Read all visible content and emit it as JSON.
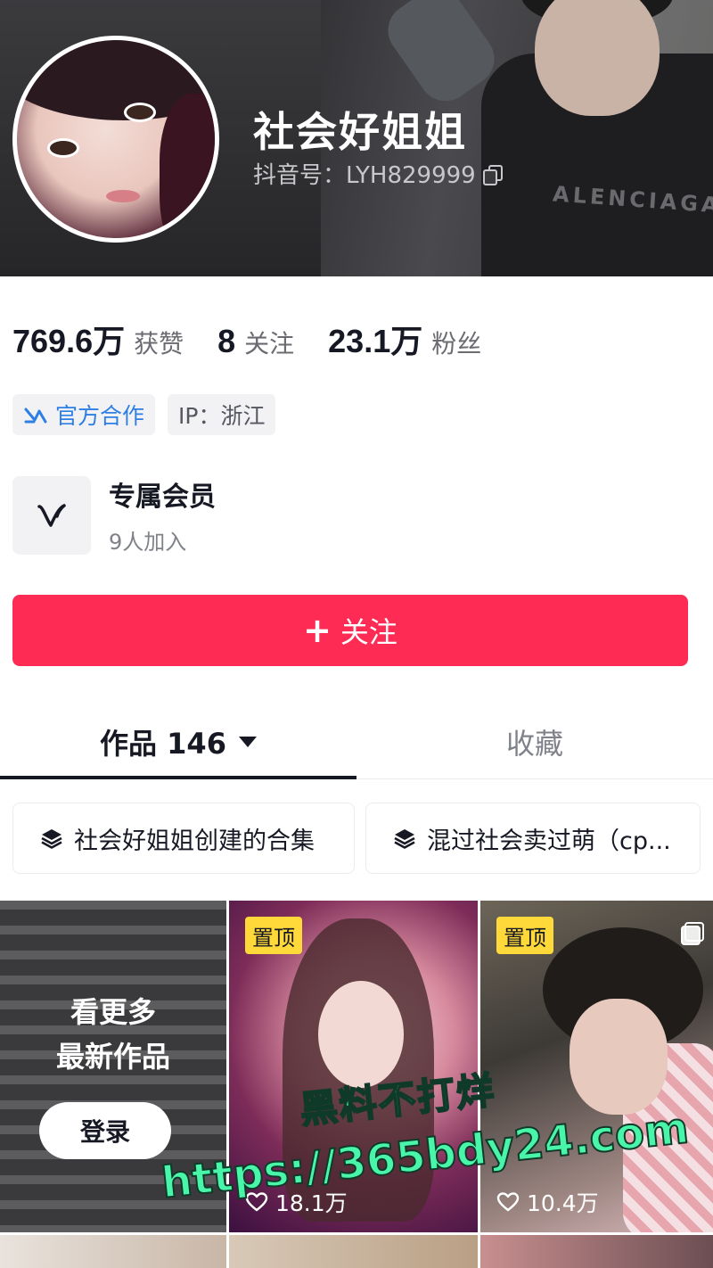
{
  "profile": {
    "nickname": "社会好姐姐",
    "douyin_id": "抖音号：LYH829999"
  },
  "stats": [
    {
      "value": "769.6万",
      "label": "获赞"
    },
    {
      "value": "8",
      "label": "关注"
    },
    {
      "value": "23.1万",
      "label": "粉丝"
    }
  ],
  "tags": {
    "official": "官方合作",
    "ip": "IP：浙江"
  },
  "member": {
    "title": "专属会员",
    "subtitle": "9人加入"
  },
  "follow_button": {
    "plus": "+",
    "label": "关注"
  },
  "tabs": {
    "works": "作品 146",
    "favorites": "收藏"
  },
  "collections": [
    {
      "label": "社会好姐姐创建的合集"
    },
    {
      "label": "混过社会卖过萌（cp..."
    }
  ],
  "grid": {
    "more_line1": "看更多",
    "more_line2": "最新作品",
    "login": "登录",
    "items": [
      {
        "pinned": "置顶",
        "likes": "18.1万"
      },
      {
        "pinned": "置顶",
        "likes": "10.4万"
      }
    ]
  },
  "cover": {
    "brand_text": "ALENCIAGA"
  },
  "watermark": {
    "line1": "黑料不打烊",
    "line2": "https://365bdy24.com"
  },
  "colors": {
    "accent": "#fe2c55",
    "official_blue": "#2e7fe3",
    "pinned_yellow": "#ffd83a",
    "watermark_green": "#49f5a8"
  }
}
